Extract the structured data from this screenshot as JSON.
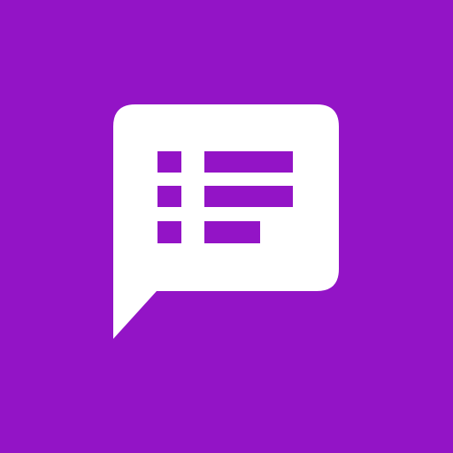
{
  "app_icon": {
    "icon": "chat-bubble-list-icon",
    "colors": {
      "background": "#9314c6",
      "foreground": "#ffffff"
    }
  }
}
